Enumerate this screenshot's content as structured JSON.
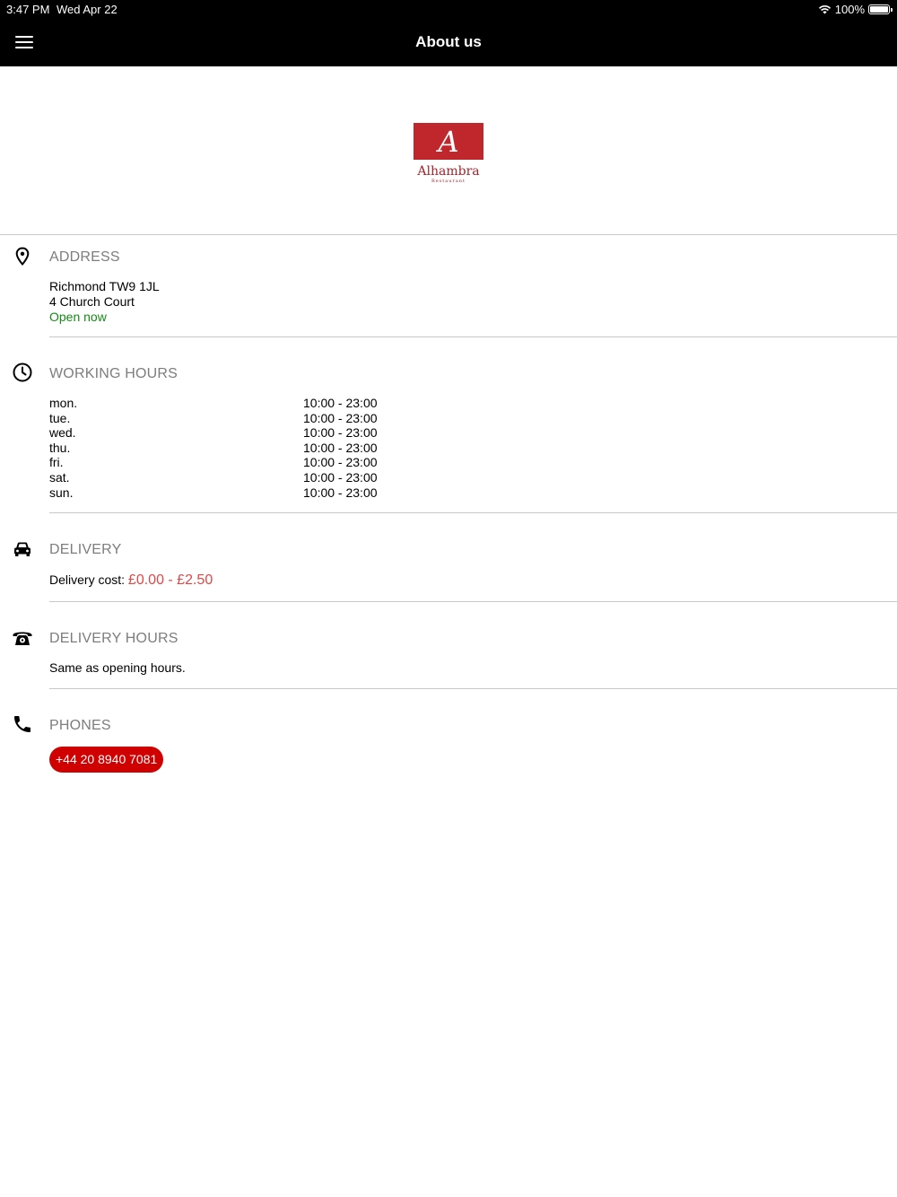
{
  "status_bar": {
    "time": "3:47 PM",
    "date": "Wed Apr 22",
    "battery": "100%"
  },
  "nav": {
    "title": "About us",
    "menu_icon": "hamburger-menu-icon"
  },
  "logo": {
    "letter": "A",
    "name": "Alhambra",
    "subtitle": "Restaurant"
  },
  "address": {
    "title": "ADDRESS",
    "icon": "location-pin-icon",
    "line1": "Richmond TW9 1JL",
    "line2": "4 Church Court",
    "status": "Open now"
  },
  "working_hours": {
    "title": "WORKING HOURS",
    "icon": "clock-icon",
    "rows": [
      {
        "day": "mon.",
        "time": "10:00 - 23:00"
      },
      {
        "day": "tue.",
        "time": "10:00 - 23:00"
      },
      {
        "day": "wed.",
        "time": "10:00 - 23:00"
      },
      {
        "day": "thu.",
        "time": "10:00 - 23:00"
      },
      {
        "day": "fri.",
        "time": "10:00 - 23:00"
      },
      {
        "day": "sat.",
        "time": "10:00 - 23:00"
      },
      {
        "day": "sun.",
        "time": "10:00 - 23:00"
      }
    ]
  },
  "delivery": {
    "title": "DELIVERY",
    "icon": "car-icon",
    "cost_label": "Delivery cost:",
    "cost_value": "£0.00 - £2.50"
  },
  "delivery_hours": {
    "title": "DELIVERY HOURS",
    "icon": "telephone-icon",
    "text": "Same as opening hours."
  },
  "phones": {
    "title": "PHONES",
    "icon": "phone-handset-icon",
    "numbers": [
      "+44 20 8940 7081"
    ]
  },
  "colors": {
    "accent_red": "#d00000",
    "open_green": "#168a16",
    "price_red": "#e04848",
    "logo_red": "#c0272d"
  }
}
